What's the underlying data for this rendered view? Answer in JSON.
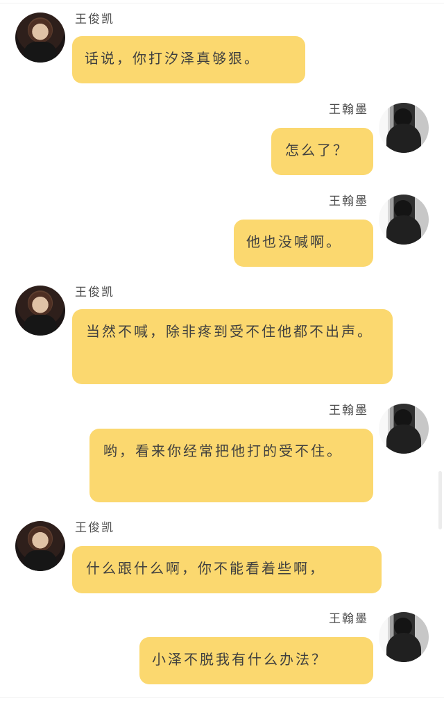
{
  "messages": [
    {
      "sender": "王俊凯",
      "text": "话说，你打汐泽真够狠。"
    },
    {
      "sender": "王翰墨",
      "text": "怎么了？"
    },
    {
      "sender": "王翰墨",
      "text": "他也没喊啊。"
    },
    {
      "sender": "王俊凯",
      "text": "当然不喊，除非疼到受不住他都不出声。"
    },
    {
      "sender": "王翰墨",
      "text": "哟，看来你经常把他打的受不住。"
    },
    {
      "sender": "王俊凯",
      "text": "什么跟什么啊，你不能看着些啊，"
    },
    {
      "sender": "王翰墨",
      "text": "小泽不脱我有什么办法？"
    }
  ],
  "colors": {
    "bubble": "#fbd86f",
    "text": "#3f3f3f",
    "name": "#4d4d4d",
    "background": "#ffffff"
  }
}
